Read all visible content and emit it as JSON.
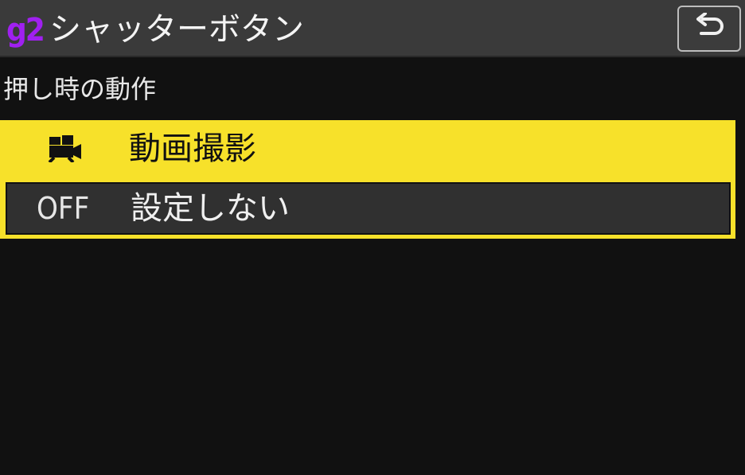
{
  "header": {
    "menu_code": "g2",
    "title": "シャッターボタン",
    "back_icon": "return-arrow-icon"
  },
  "section": {
    "label": "押し時の動作"
  },
  "options": [
    {
      "icon": "movie-camera-icon",
      "label": "動画撮影",
      "selected": true
    },
    {
      "icon_text": "OFF",
      "label": "設定しない",
      "selected": false
    }
  ],
  "colors": {
    "accent_yellow": "#f7e12a",
    "menu_code_purple": "#a020f0",
    "header_bg": "#3a3a3a",
    "background": "#111111"
  }
}
